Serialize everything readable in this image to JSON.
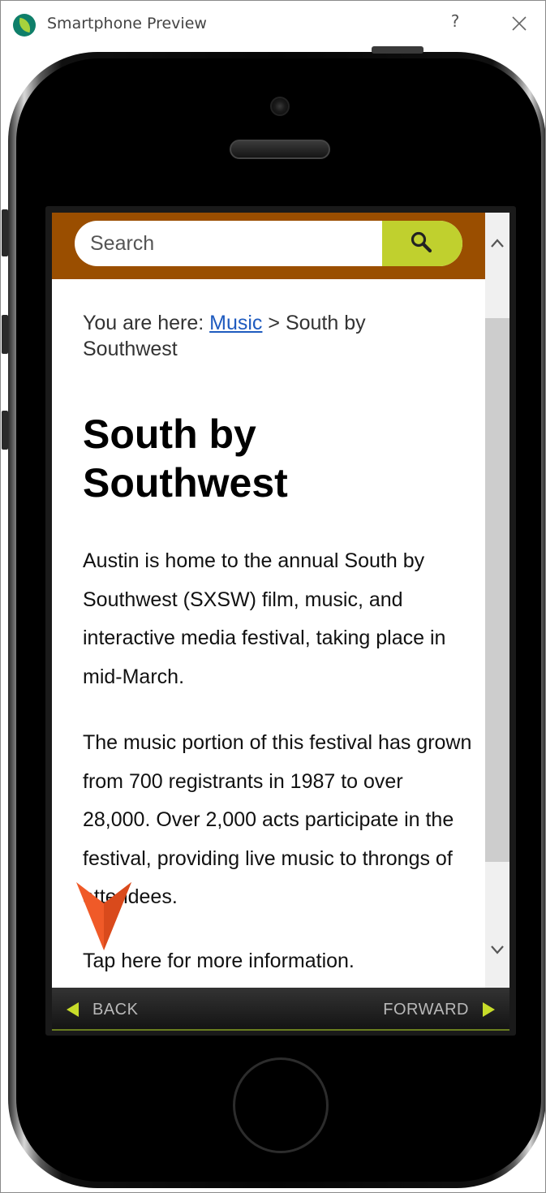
{
  "window": {
    "title": "Smartphone Preview",
    "help_label": "?"
  },
  "colors": {
    "search_bar_bg": "#9a4e00",
    "search_button_bg": "#c0d02e",
    "link": "#1f5bbf",
    "nav_arrow": "#c7dc2a",
    "tap_cursor": "#f05a28",
    "app_logo": "#0f7f6a"
  },
  "icons": {
    "app": "leaf-logo-icon",
    "search": "magnifier-icon",
    "close": "close-x-icon",
    "scroll_up": "chevron-up-icon",
    "scroll_down": "chevron-down-icon",
    "back": "triangle-left-icon",
    "forward": "triangle-right-icon",
    "cursor": "tap-pointer-icon"
  },
  "search": {
    "placeholder": "Search",
    "value": ""
  },
  "breadcrumb": {
    "prefix": "You are here: ",
    "link_label": "Music",
    "separator": " > ",
    "current": "South by Southwest"
  },
  "page": {
    "title": "South by Southwest",
    "paragraph1": "Austin is home to the annual South by Southwest (SXSW) film, music, and interactive media festival, taking place in mid-March.",
    "paragraph2": "The music portion of this festival has grown from 700 registrants in 1987 to over 28,000. Over 2,000 acts participate in the festival, providing live music to throngs of attendees.",
    "tap_link": "Tap here for more information."
  },
  "nav": {
    "back_label": "BACK",
    "forward_label": "FORWARD"
  }
}
